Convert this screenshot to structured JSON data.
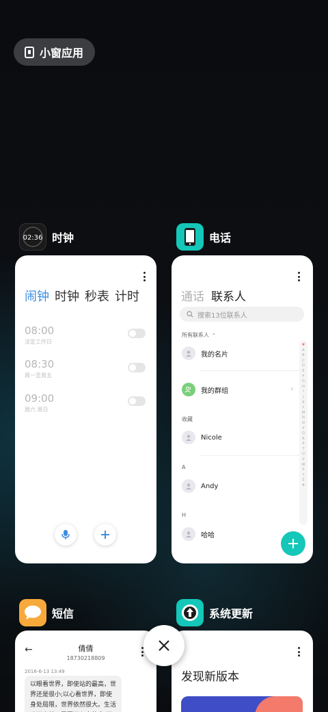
{
  "floating_window": {
    "label": "小窗应用"
  },
  "apps": {
    "clock": {
      "title": "时钟",
      "icon_time": "02:36",
      "icon": "clock-icon",
      "tabs": [
        "闹钟",
        "时钟",
        "秒表",
        "计时"
      ],
      "active_tab": "闹钟",
      "alarms": [
        {
          "time": "08:00",
          "repeat": "法定工作日",
          "enabled": false
        },
        {
          "time": "08:30",
          "repeat": "周一至周五",
          "enabled": false
        },
        {
          "time": "09:00",
          "repeat": "周六 周日",
          "enabled": false
        }
      ]
    },
    "phone": {
      "title": "电话",
      "icon": "phone-icon",
      "accent": "#14c7b8",
      "tabs": [
        "通话",
        "联系人"
      ],
      "active_tab": "联系人",
      "search_placeholder": "搜索13位联系人",
      "filter_label": "所有联系人",
      "contacts": {
        "my_card": "我的名片",
        "my_groups": "我的群组",
        "favorites_header": "收藏",
        "favorite": "Nicole",
        "a_header": "A",
        "a_contact": "Andy",
        "h_header": "H",
        "h_contact": "哈哈"
      },
      "alphabet": [
        "♥",
        "A",
        "B",
        "C",
        "D",
        "E",
        "F",
        "G",
        "H",
        "I",
        "J",
        "K",
        "L",
        "M",
        "N",
        "O",
        "P",
        "Q",
        "R",
        "S",
        "T",
        "U",
        "V",
        "W",
        "X",
        "Y",
        "Z",
        "#"
      ]
    },
    "sms": {
      "title": "短信",
      "icon": "message-icon",
      "contact_name": "倩倩",
      "contact_number": "18730218809",
      "timestamp": "2016-6-13 13:49",
      "message": "以眼看世界，即使站的最高，世界还是很小;以心看世界，即使身处局限，世界依然很大。生活远不完美，需要用心去体会,不要把自己"
    },
    "updater": {
      "title": "系统更新",
      "icon": "update-icon",
      "heading": "发现新版本"
    }
  }
}
